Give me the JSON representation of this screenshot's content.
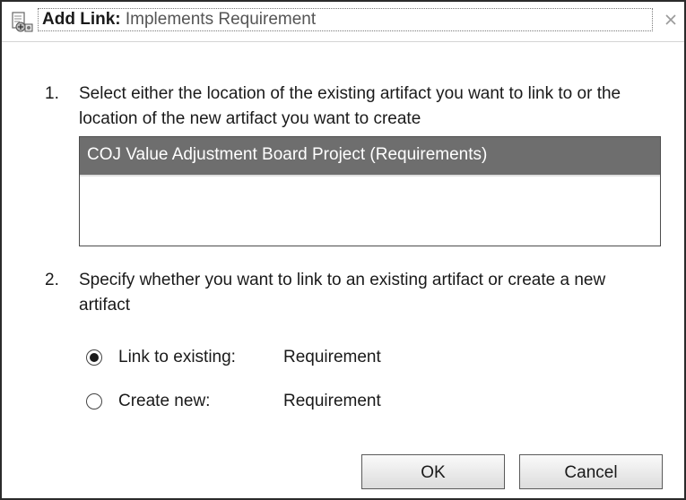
{
  "dialog": {
    "title_bold": "Add Link:",
    "title_rest": " Implements Requirement",
    "icons": {
      "app": "add-link-icon",
      "close": "close-icon"
    }
  },
  "step1": {
    "number": "1.",
    "text": "Select either the location of the existing artifact you want to link to or the location of the new artifact you want to create",
    "list": {
      "items": [
        "COJ Value Adjustment Board Project (Requirements)"
      ],
      "selected_index": 0
    }
  },
  "step2": {
    "number": "2.",
    "text": "Specify whether you want to link to an existing artifact or create a new artifact",
    "options": [
      {
        "label": "Link to existing:",
        "value": "Requirement",
        "selected": true
      },
      {
        "label": "Create new:",
        "value": "Requirement",
        "selected": false
      }
    ]
  },
  "buttons": {
    "ok": "OK",
    "cancel": "Cancel"
  },
  "colors": {
    "selection": "#6e6e6e",
    "border": "#2b2b2b"
  }
}
